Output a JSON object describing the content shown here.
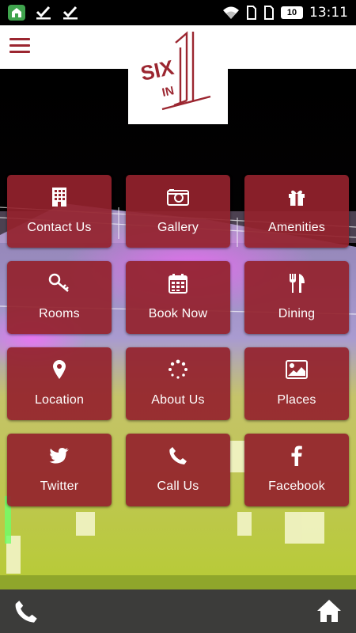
{
  "status_bar": {
    "battery": "10",
    "time": "13:11",
    "icons": [
      "app-notification-icon",
      "check-icon",
      "check-icon",
      "wifi-icon",
      "sim-icon",
      "sim-icon",
      "battery-icon"
    ]
  },
  "header": {
    "menu_icon": "hamburger-menu-icon",
    "logo_text_main": "SIX",
    "logo_text_sub": "IN",
    "logo_numeral": "1",
    "brand_color": "#9b2630"
  },
  "tiles": [
    {
      "label": "Contact Us",
      "icon": "building-icon"
    },
    {
      "label": "Gallery",
      "icon": "camera-icon"
    },
    {
      "label": "Amenities",
      "icon": "gift-icon"
    },
    {
      "label": "Rooms",
      "icon": "key-icon"
    },
    {
      "label": "Book Now",
      "icon": "calendar-icon"
    },
    {
      "label": "Dining",
      "icon": "utensils-icon"
    },
    {
      "label": "Location",
      "icon": "map-pin-icon"
    },
    {
      "label": "About Us",
      "icon": "spinner-icon"
    },
    {
      "label": "Places",
      "icon": "image-icon"
    },
    {
      "label": "Twitter",
      "icon": "twitter-icon"
    },
    {
      "label": "Call Us",
      "icon": "phone-icon"
    },
    {
      "label": "Facebook",
      "icon": "facebook-icon"
    }
  ],
  "bottom_bar": {
    "left_icon": "phone-icon",
    "right_icon": "home-icon"
  },
  "colors": {
    "tile": "#94222c",
    "bottom_bar": "#3c3c3a"
  }
}
